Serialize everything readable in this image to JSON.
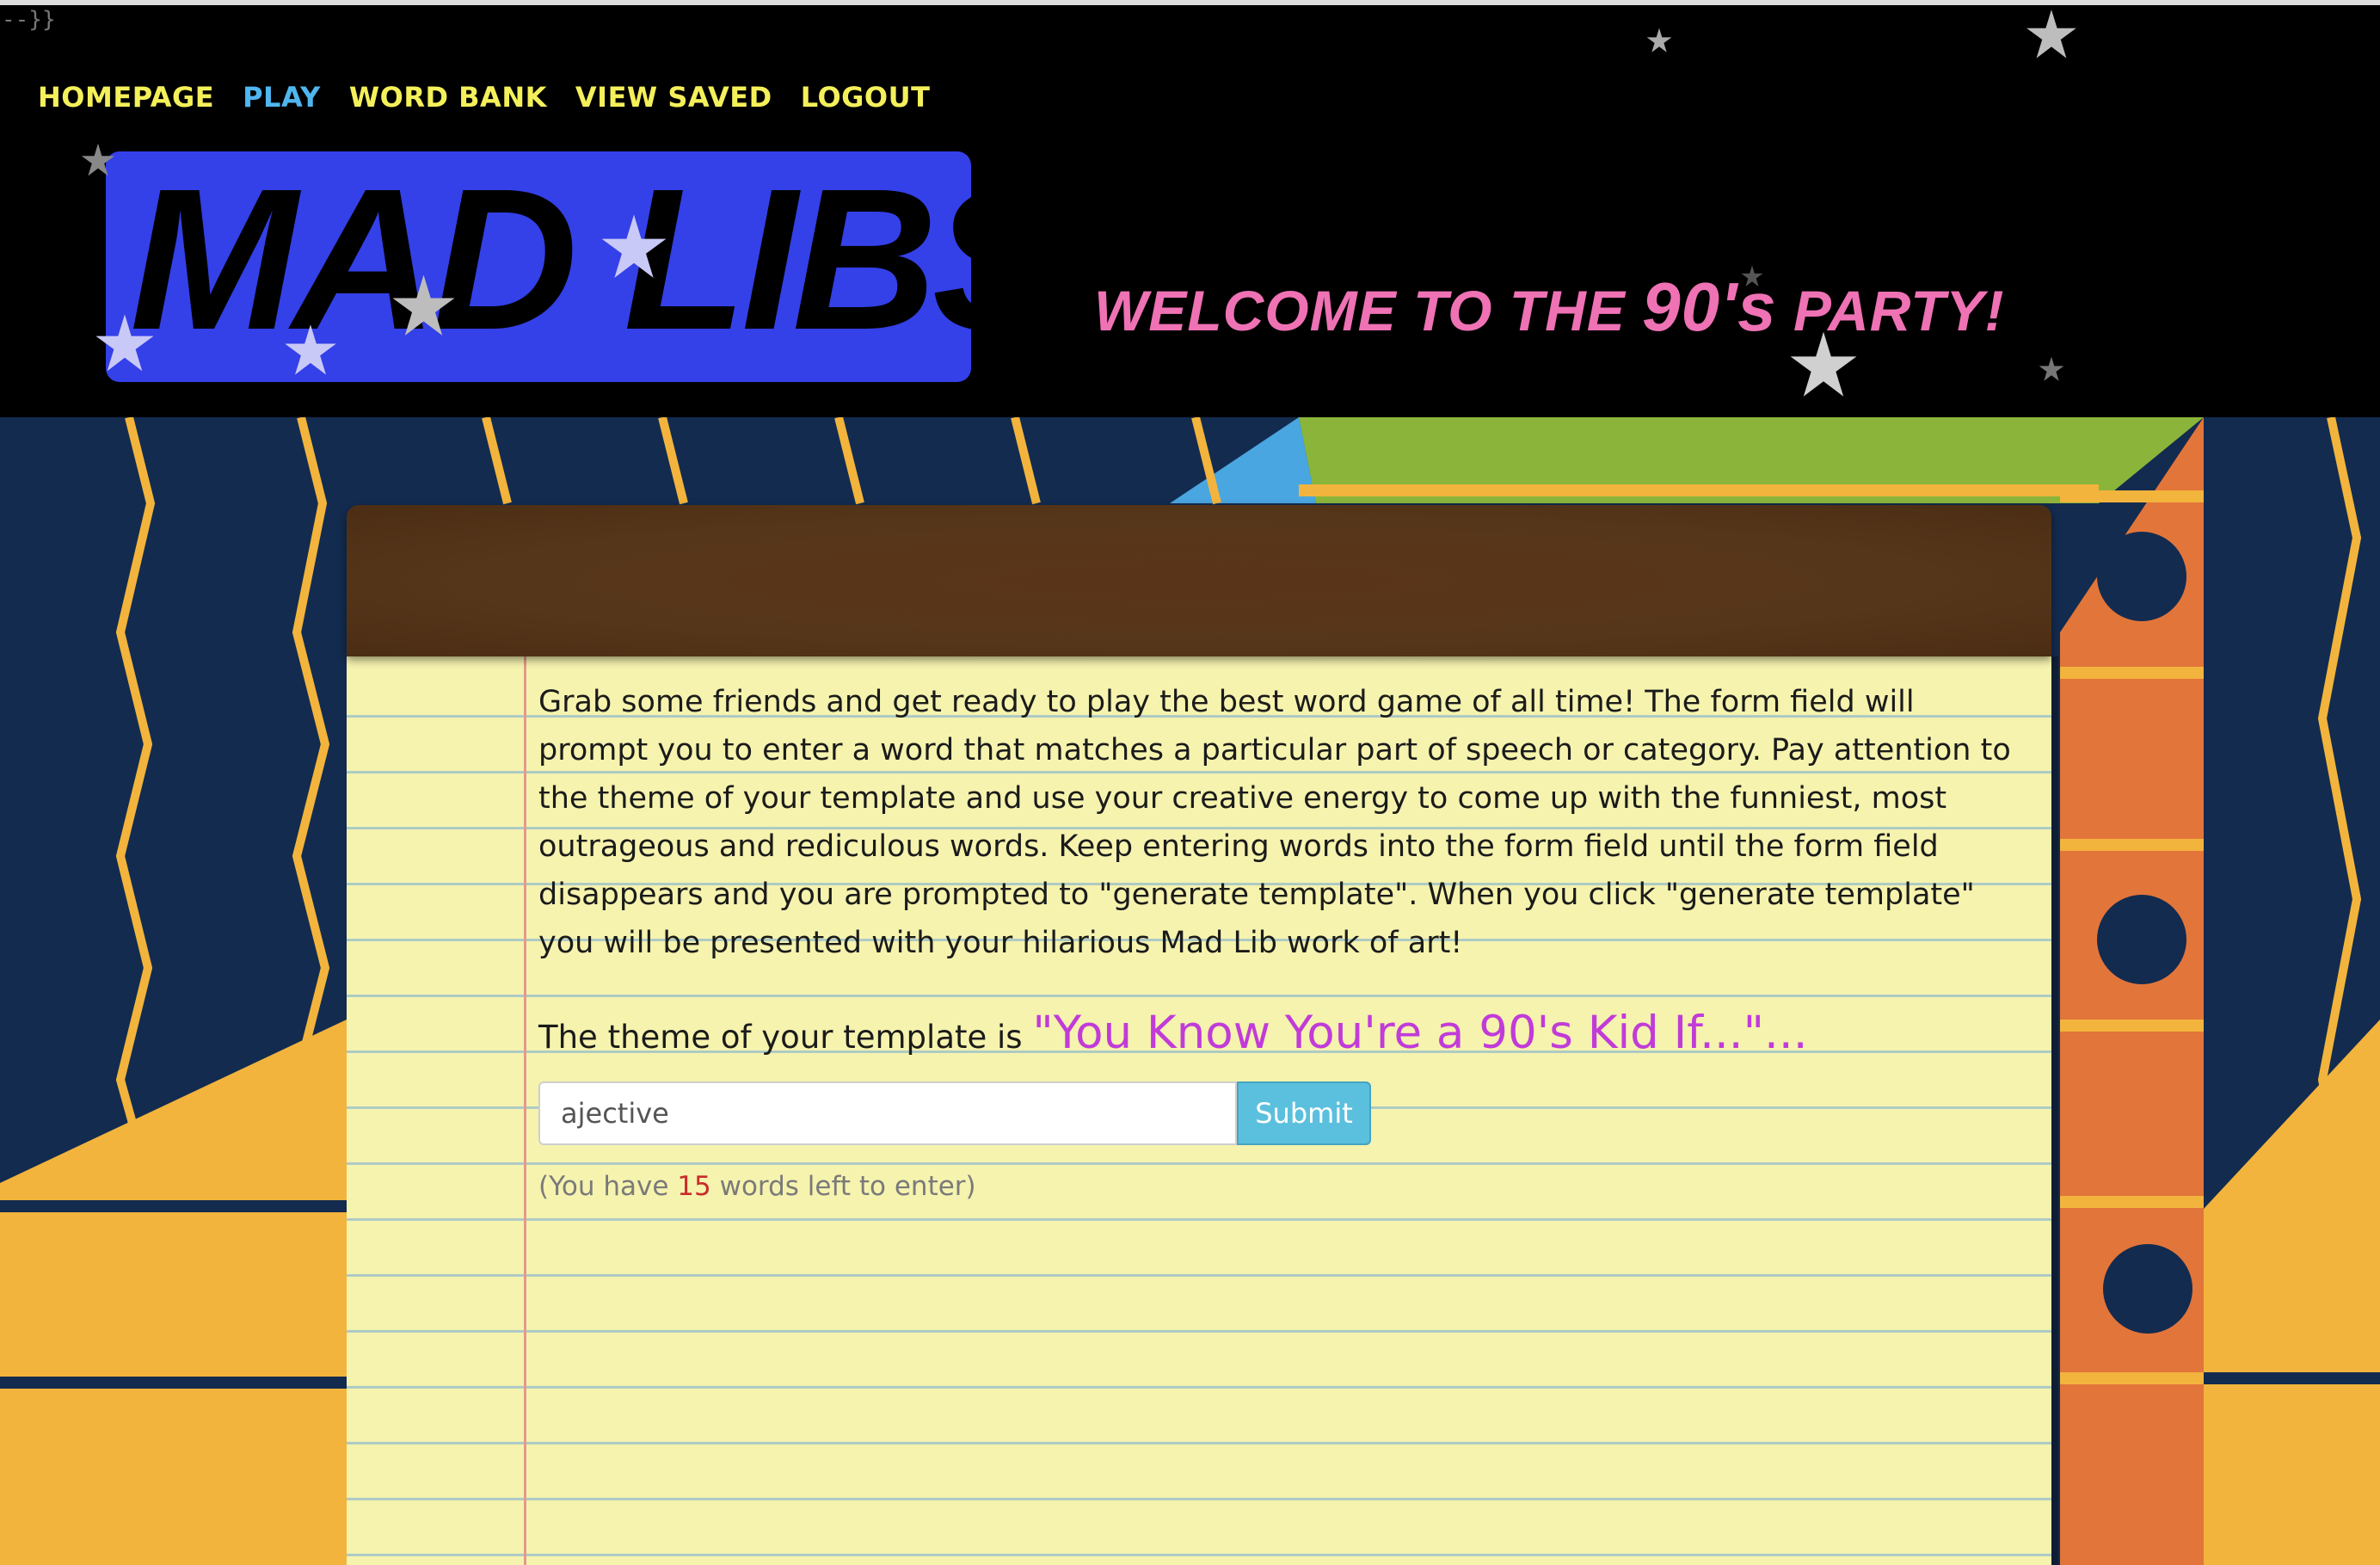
{
  "page": {
    "stray_text": "--}}"
  },
  "nav": {
    "items": [
      {
        "label": "HOMEPAGE",
        "active": false
      },
      {
        "label": "PLAY",
        "active": true
      },
      {
        "label": "WORD BANK",
        "active": false
      },
      {
        "label": "VIEW SAVED",
        "active": false
      },
      {
        "label": "LOGOUT",
        "active": false
      }
    ],
    "colors": {
      "default": "#f4f05a",
      "active": "#4fb6f0"
    }
  },
  "header": {
    "logo_text": "MAD LIBS",
    "welcome_prefix": "WELCOME TO THE ",
    "welcome_big": "90's",
    "welcome_suffix": " PARTY!",
    "colors": {
      "logo_bg": "#3440e8",
      "welcome": "#ee72b4"
    }
  },
  "main": {
    "intro": "Grab some friends and get ready to play the best word game of all time! The form field will prompt you to enter a word that matches a particular part of speech or category. Pay attention to the theme of your template and use your creative energy to come up with the funniest, most outrageous and rediculous words. Keep entering words into the form field until the form field disappears and you are prompted to \"generate template\". When you click \"generate template\" you will be presented with your hilarious Mad Lib work of art!",
    "theme_label": "The theme of your template is ",
    "theme_value": "\"You Know You're a 90's Kid If...\"...",
    "input_value": "ajective",
    "submit_label": "Submit",
    "remaining_prefix": "(You have ",
    "remaining_count": "15",
    "remaining_suffix": " words left to enter)"
  },
  "icons": [
    "star-icon"
  ]
}
